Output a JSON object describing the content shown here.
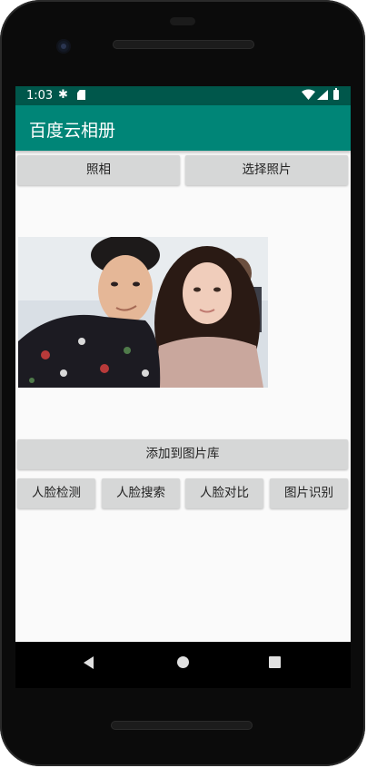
{
  "status_bar": {
    "time": "1:03"
  },
  "app_bar": {
    "title": "百度云相册"
  },
  "buttons": {
    "take_photo": "照相",
    "choose_photo": "选择照片",
    "add_to_library": "添加到图片库",
    "face_detect": "人脸检测",
    "face_search": "人脸搜索",
    "face_compare": "人脸对比",
    "image_recognition": "图片识别"
  },
  "colors": {
    "status_bar": "#00574b",
    "app_bar": "#008577",
    "button": "#d6d7d7",
    "background": "#fafafa"
  },
  "icons": [
    "settings-icon",
    "sd-card-icon",
    "wifi-icon",
    "signal-icon",
    "battery-icon",
    "back-icon",
    "home-icon",
    "recents-icon"
  ]
}
